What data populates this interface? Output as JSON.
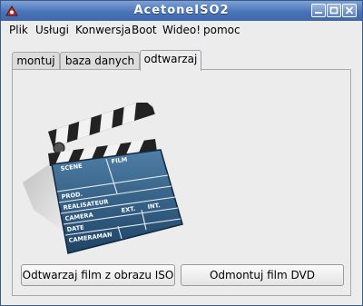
{
  "window": {
    "title": "AcetoneISO2"
  },
  "menu": [
    "Plik",
    "Usługi",
    "Konwersja",
    "Boot",
    "Wideo!",
    "pomoc"
  ],
  "tabs": [
    {
      "label": "montuj",
      "active": false
    },
    {
      "label": "baza danych",
      "active": false
    },
    {
      "label": "odtwarzaj",
      "active": true
    }
  ],
  "clapperboard": {
    "scene": "SCENE",
    "film": "FILM",
    "prod": "PROD.",
    "realisateur": "REALISATEUR",
    "camera": "CAMERA",
    "ext": "EXT.",
    "int": "INT.",
    "date": "DATE",
    "cameraman": "CAMERAMAN"
  },
  "buttons": {
    "play_iso": "Odtwarzaj film z obrazu ISO",
    "unmount_dvd": "Odmontuj film DVD"
  },
  "colors": {
    "titlebar": "#4a74b8",
    "board": "#2f5f86"
  }
}
